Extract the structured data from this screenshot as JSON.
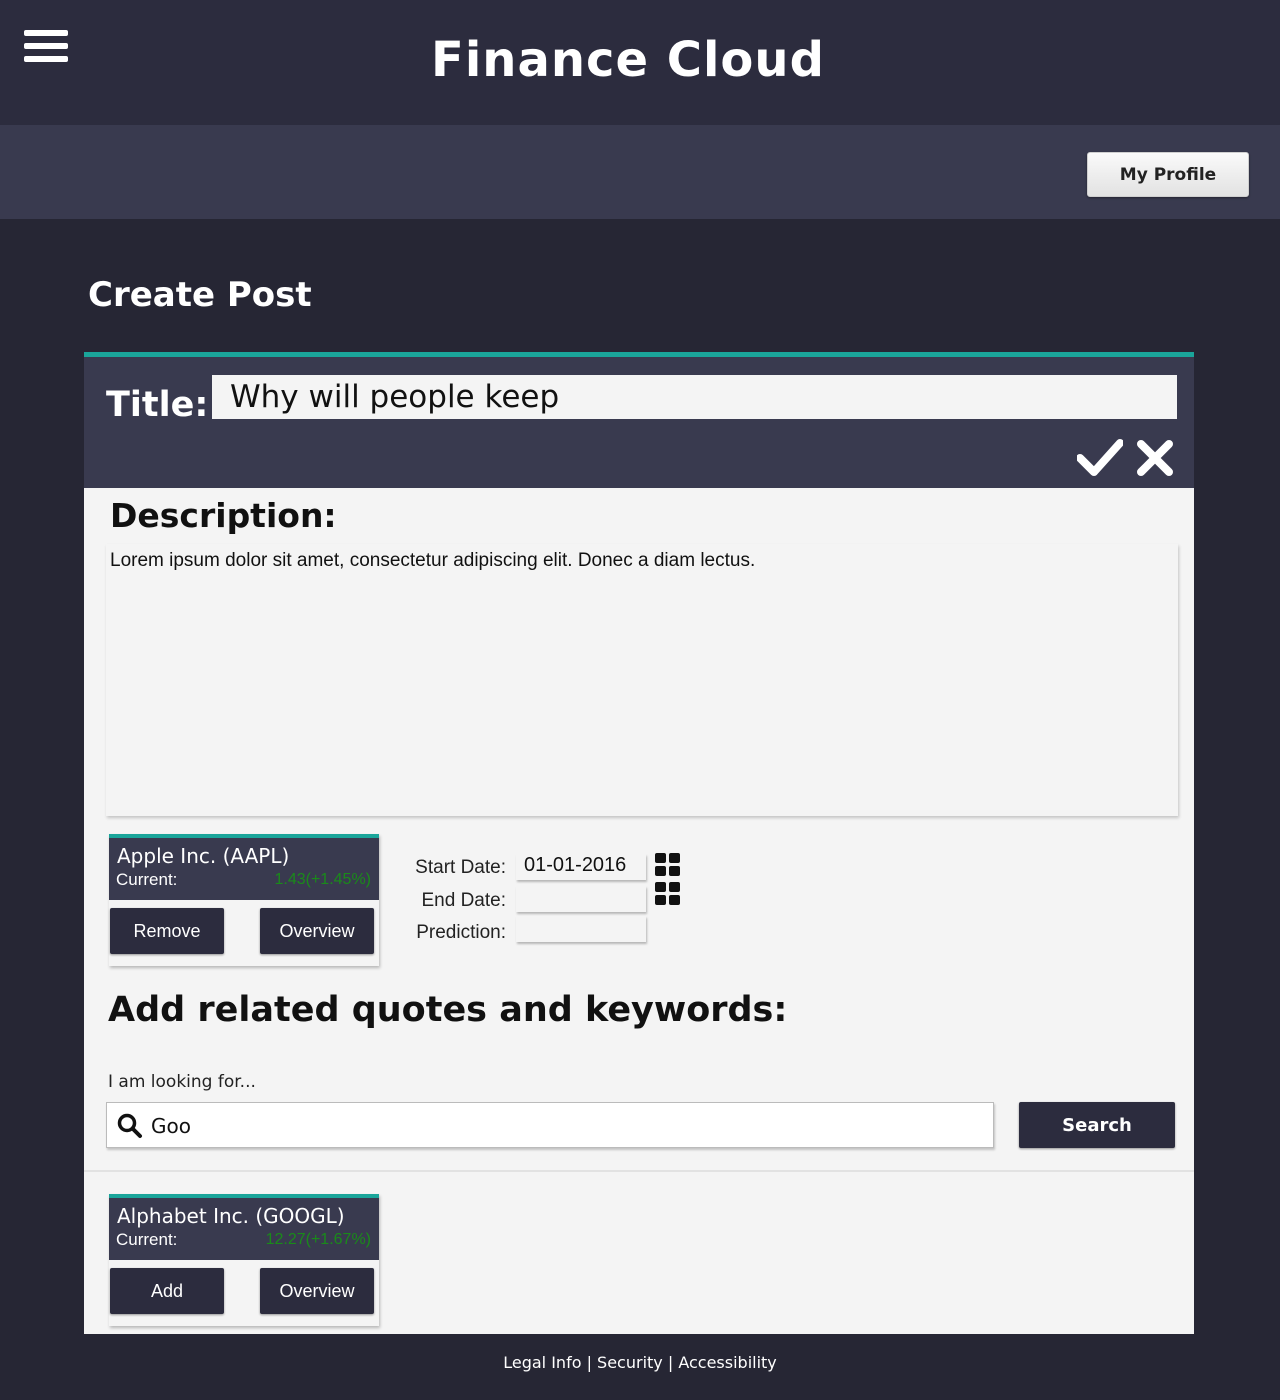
{
  "app": {
    "title": "Finance Cloud"
  },
  "header": {
    "profile_label": "My Profile"
  },
  "page": {
    "heading": "Create Post"
  },
  "post": {
    "title_label": "Title:",
    "title_value": "Why will people keep",
    "description_label": "Description:",
    "description_text": "Lorem ipsum dolor sit amet, consectetur adipiscing elit. Donec a diam lectus."
  },
  "selected_quote": {
    "name": "Apple Inc. (AAPL)",
    "current_label": "Current:",
    "change": "1.43(+1.45%)",
    "change_color": "#1a8a1a",
    "remove_label": "Remove",
    "overview_label": "Overview"
  },
  "dates": {
    "start_label": "Start Date:",
    "start_value": "01-01-2016",
    "end_label": "End Date:",
    "end_value": "",
    "prediction_label": "Prediction:",
    "prediction_value": ""
  },
  "related": {
    "heading": "Add related quotes and keywords:",
    "search_label": "I am looking for...",
    "search_value": "Goo",
    "search_button": "Search"
  },
  "result_quote": {
    "name": "Alphabet Inc. (GOOGL)",
    "current_label": "Current:",
    "change": "12.27(+1.67%)",
    "change_color": "#1a8a1a",
    "add_label": "Add",
    "overview_label": "Overview"
  },
  "footer": {
    "legal": "Legal Info",
    "security": "Security",
    "accessibility": "Accessibility",
    "separator": " | "
  },
  "colors": {
    "accent": "#1aa59a",
    "dark": "#2c2c3e",
    "panel": "#393a4f"
  }
}
